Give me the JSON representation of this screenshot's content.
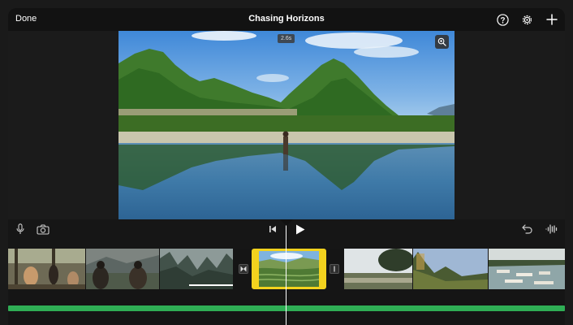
{
  "topbar": {
    "done_label": "Done",
    "title": "Chasing Horizons",
    "icons": [
      "help-icon",
      "settings-gear-icon",
      "add-plus-icon"
    ]
  },
  "viewer": {
    "duration_badge": "2.6s",
    "zoom_icon": "zoom-in-icon"
  },
  "controls": {
    "left_icons": [
      "microphone-icon",
      "camera-icon"
    ],
    "center_icons": [
      "skip-to-start-icon",
      "play-icon"
    ],
    "right_icons": [
      "undo-icon",
      "audio-waveform-icon"
    ]
  },
  "timeline": {
    "clips": [
      "hikers-forest-clip",
      "hikers-mountain-clip",
      "karst-valley-clip",
      "mountain-river-clip",
      "riverside-trees-clip",
      "karst-peak-clip",
      "boats-river-clip"
    ],
    "selected_clip": "rice-terraces-clip",
    "transitions": [
      "cross-dissolve-transition",
      "none-transition"
    ],
    "audio_track_color": "#2fae55",
    "selection_color": "#f3d21e"
  }
}
